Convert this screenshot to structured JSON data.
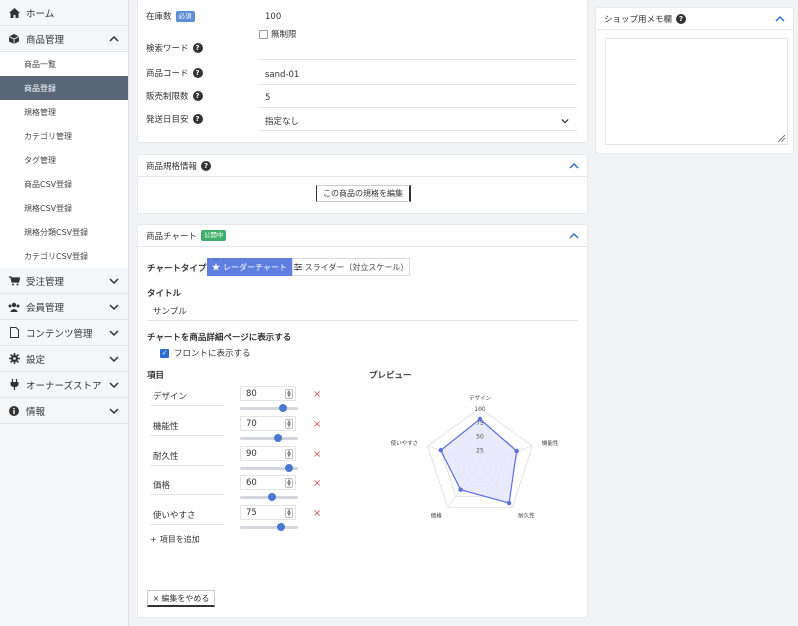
{
  "sidebar": {
    "home": "ホーム",
    "products": "商品管理",
    "product_sub": [
      "商品一覧",
      "商品登録",
      "規格管理",
      "カテゴリ管理",
      "タグ管理",
      "商品CSV登録",
      "規格CSV登録",
      "規格分類CSV登録",
      "カテゴリCSV登録"
    ],
    "orders": "受注管理",
    "members": "会員管理",
    "contents": "コンテンツ管理",
    "settings": "設定",
    "owners": "オーナーズストア",
    "info": "情報"
  },
  "basic": {
    "stock_label": "在庫数",
    "required": "必須",
    "stock_value": "100",
    "unlimited_label": "無制限",
    "keyword_label": "検索ワード",
    "code_label": "商品コード",
    "code_value": "sand-01",
    "limit_label": "販売制限数",
    "limit_value": "5",
    "delivery_label": "発送日目安",
    "delivery_value": "指定なし"
  },
  "spec": {
    "title": "商品規格情報",
    "button": "この商品の規格を編集"
  },
  "chart_card": {
    "title": "商品チャート",
    "status": "公開中",
    "type_label": "チャートタイプ",
    "tab_radar": "レーダーチャート",
    "tab_slider": "スライダー（対立スケール）",
    "title_label": "タイトル",
    "title_value": "サンプル",
    "show_label": "チャートを商品詳細ページに表示する",
    "front_label": "フロントに表示する",
    "items_label": "項目",
    "preview_label": "プレビュー",
    "add_item": "項目を追加",
    "stop_edit": "編集をやめる",
    "items": [
      {
        "name": "デザイン",
        "value": "80"
      },
      {
        "name": "機能性",
        "value": "70"
      },
      {
        "name": "耐久性",
        "value": "90"
      },
      {
        "name": "価格",
        "value": "60"
      },
      {
        "name": "使いやすさ",
        "value": "75"
      }
    ],
    "scale_labels": [
      "100",
      "75",
      "50",
      "25"
    ]
  },
  "memo": {
    "title": "ショップ用メモ欄"
  },
  "chart_data": {
    "type": "radar",
    "categories": [
      "デザイン",
      "機能性",
      "耐久性",
      "価格",
      "使いやすさ"
    ],
    "values": [
      80,
      70,
      90,
      60,
      75
    ],
    "ylim": [
      0,
      100
    ],
    "ticks": [
      25,
      50,
      75,
      100
    ],
    "colors": {
      "fill": "#e3e6fb",
      "stroke": "#5a6fe0",
      "point": "#5a6fe0"
    }
  }
}
